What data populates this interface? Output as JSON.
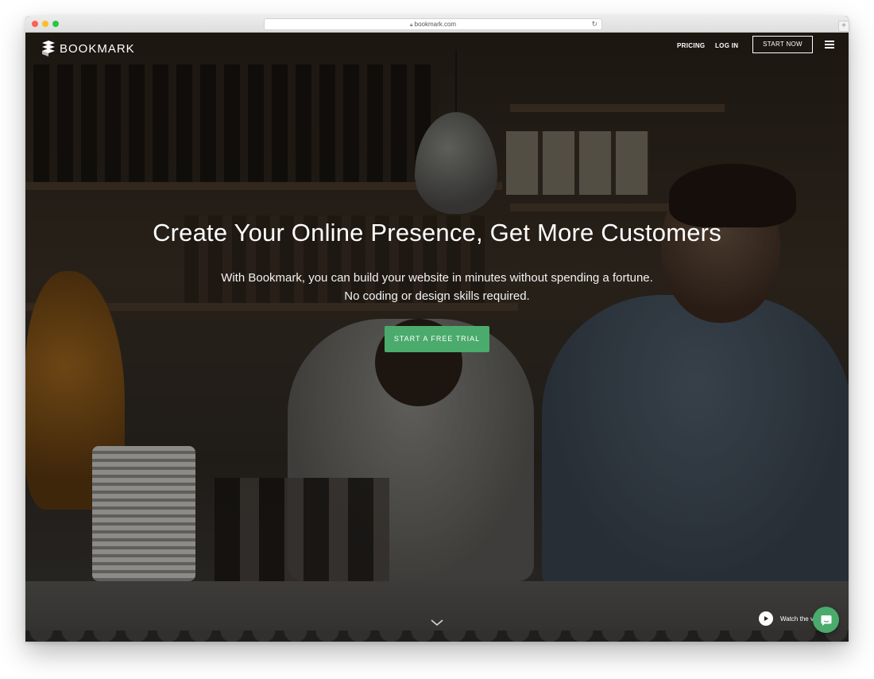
{
  "browser": {
    "url": "bookmark.com",
    "new_tab_label": "+"
  },
  "nav": {
    "logo_text": "BOOKMARK",
    "pricing": "PRICING",
    "login": "LOG IN",
    "start_now": "START NOW"
  },
  "hero": {
    "headline": "Create Your Online Presence, Get More Customers",
    "sub_line1": "With Bookmark, you can build your website in minutes without spending a fortune.",
    "sub_line2": "No coding or design skills required.",
    "cta": "START A FREE TRIAL"
  },
  "video": {
    "watch_label": "Watch the v"
  },
  "icons": {
    "logo": "bookmark-logo-icon",
    "menu": "hamburger-menu-icon",
    "scroll": "chevron-down-icon",
    "play": "play-icon",
    "chat": "chat-bubble-icon",
    "lock": "lock-icon",
    "reload": "reload-icon"
  },
  "colors": {
    "accent": "#4aab6c",
    "text_light": "#ffffff"
  }
}
